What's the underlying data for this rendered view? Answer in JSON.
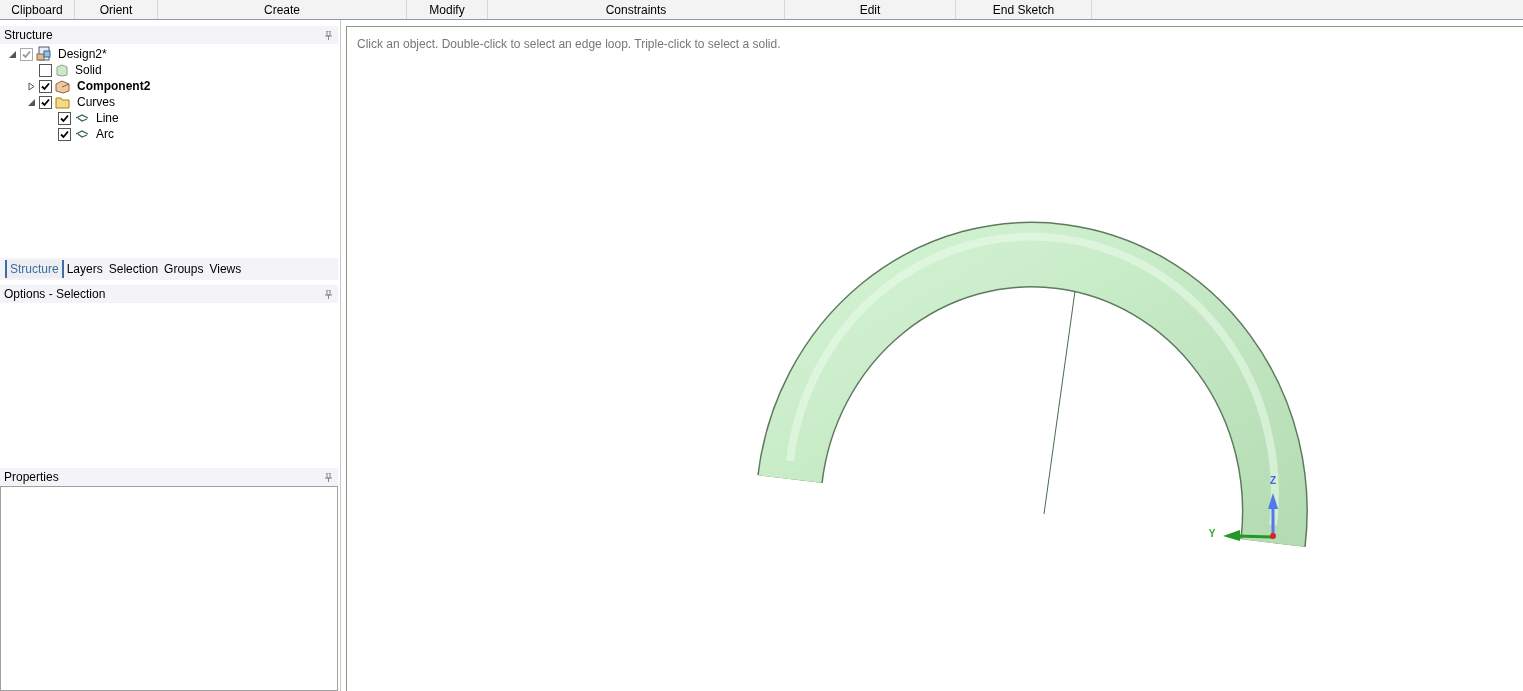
{
  "ribbon": [
    {
      "label": "Clipboard"
    },
    {
      "label": "Orient"
    },
    {
      "label": "Create"
    },
    {
      "label": "Modify"
    },
    {
      "label": "Constraints"
    },
    {
      "label": "Edit"
    },
    {
      "label": "End Sketch"
    }
  ],
  "structure": {
    "title": "Structure",
    "tree": [
      {
        "label": "Design2*",
        "kind": "design",
        "checked": true,
        "expanded": true,
        "active": false,
        "children": [
          {
            "label": "Solid",
            "kind": "solid",
            "checked": false,
            "active": false
          },
          {
            "label": "Component2",
            "kind": "component",
            "checked": true,
            "expanded": false,
            "active": true
          },
          {
            "label": "Curves",
            "kind": "folder",
            "checked": true,
            "expanded": true,
            "active": false,
            "children": [
              {
                "label": "Line",
                "kind": "curve",
                "checked": true,
                "active": false
              },
              {
                "label": "Arc",
                "kind": "curve",
                "checked": true,
                "active": false
              }
            ]
          }
        ]
      }
    ]
  },
  "tabs": [
    {
      "label": "Structure",
      "selected": true
    },
    {
      "label": "Layers",
      "selected": false
    },
    {
      "label": "Selection",
      "selected": false
    },
    {
      "label": "Groups",
      "selected": false
    },
    {
      "label": "Views",
      "selected": false
    }
  ],
  "options": {
    "title": "Options - Selection"
  },
  "properties": {
    "title": "Properties"
  },
  "viewport": {
    "hint": "Click an object. Double-click to select an edge loop. Triple-click to select a solid.",
    "axis_z": "Z",
    "axis_y": "Y"
  }
}
